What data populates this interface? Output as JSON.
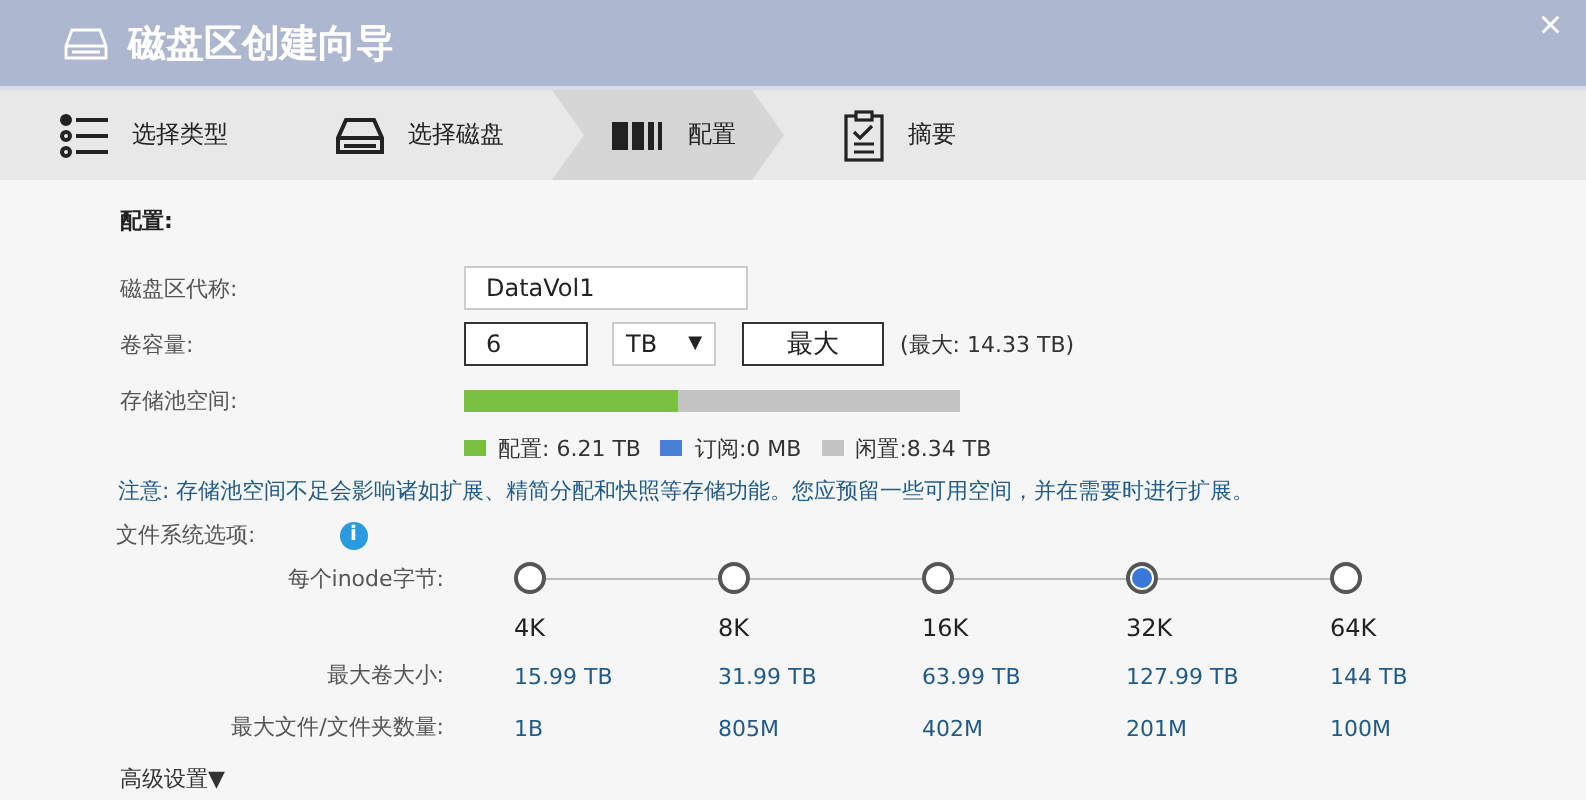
{
  "window": {
    "title": "磁盘区创建向导",
    "close": "×"
  },
  "steps": [
    {
      "label": "选择类型",
      "kind": "list",
      "selected": false
    },
    {
      "label": "选择磁盘",
      "kind": "disk",
      "selected": false
    },
    {
      "label": "配置",
      "kind": "bars",
      "selected": true
    },
    {
      "label": "摘要",
      "kind": "clipboard",
      "selected": false
    }
  ],
  "section_title": "配置:",
  "name_field": {
    "label": "磁盘区代称:",
    "value": "DataVol1"
  },
  "capacity": {
    "label": "卷容量:",
    "value": "6",
    "unit": "TB",
    "unit_caret": "▼",
    "max_button": "最大",
    "max_note": "(最大:  14.33 TB)"
  },
  "pool": {
    "label": "存储池空间:",
    "level": 0.43,
    "legend": [
      {
        "label": "配置:  6.21 TB",
        "color": "#7ac143"
      },
      {
        "label": "订阅:0 MB",
        "color": "#4a7fd6"
      },
      {
        "label": "闲置:8.34 TB",
        "color": "#c4c4c4"
      }
    ]
  },
  "note": "注意: 存储池空间不足会影响诸如扩展、精简分配和快照等存储功能。您应预留一些可用空间，并在需要时进行扩展。",
  "fs_options": {
    "label": "文件系统选项:",
    "info": "i",
    "inode_label": "每个inode字节:",
    "max_volume_label": "最大卷大小:",
    "max_files_label": "最大文件/文件夹数量:",
    "options": [
      {
        "label": "4K",
        "max_volume": "15.99 TB",
        "max_files": "1B",
        "selected": false
      },
      {
        "label": "8K",
        "max_volume": "31.99 TB",
        "max_files": "805M",
        "selected": false
      },
      {
        "label": "16K",
        "max_volume": "63.99 TB",
        "max_files": "402M",
        "selected": false
      },
      {
        "label": "32K",
        "max_volume": "127.99 TB",
        "max_files": "201M",
        "selected": true
      },
      {
        "label": "64K",
        "max_volume": "144 TB",
        "max_files": "100M",
        "selected": false
      }
    ]
  },
  "advanced": "高级设置▼"
}
